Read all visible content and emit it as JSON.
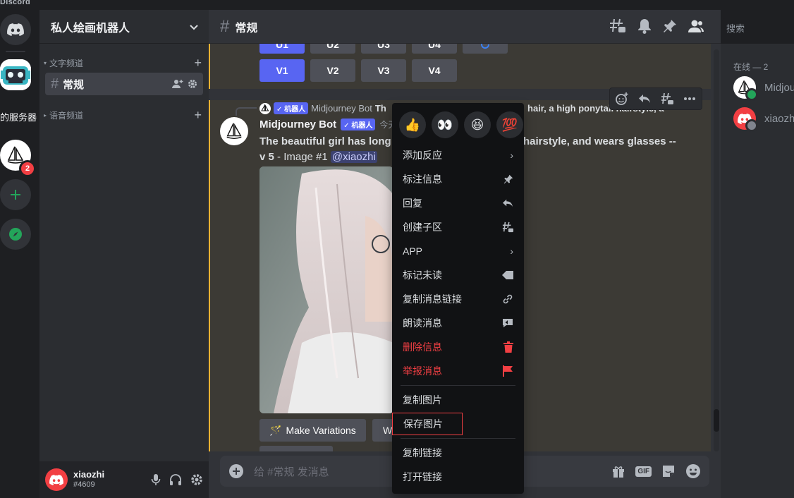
{
  "app": {
    "brand": "Discord"
  },
  "rail": {
    "server_label": "的服务器",
    "badge": "2"
  },
  "guild": {
    "name": "私人绘画机器人"
  },
  "categories": {
    "text": "文字频道",
    "voice": "语音频道"
  },
  "channel": {
    "name": "常规"
  },
  "user": {
    "name": "xiaozhi",
    "tag": "#4609"
  },
  "header": {
    "channel_title": "常规",
    "search_placeholder": "搜索"
  },
  "upscale_buttons_top": [
    "U1",
    "U2",
    "U3",
    "U4"
  ],
  "variation_buttons": [
    "V1",
    "V2",
    "V3",
    "V4"
  ],
  "message": {
    "reply_author": "Midjourney Bot",
    "reply_badge": "✓ 机器人",
    "reply_snippet_left": "Th",
    "reply_snippet_right": "hair, a high ponytail hairstyle, a",
    "author": "Midjourney Bot",
    "author_badge": "✓ 机器人",
    "time": "今天",
    "text_part1": "The beautiful girl has long",
    "text_part2": "hairstyle, and wears glasses --",
    "text_v": "v 5",
    "text_image": " - Image #1 ",
    "mention": "@xiaozhi",
    "make_variations": "Make Variations",
    "web_truncated": "W"
  },
  "composer": {
    "placeholder": "给 #常规 发消息"
  },
  "members": {
    "header": "在线 — 2",
    "list": [
      {
        "name": "Midjou",
        "status": "online"
      },
      {
        "name": "xiaozhi",
        "status": "offline"
      }
    ]
  },
  "context_menu": {
    "reactions": [
      "👍",
      "👀",
      "😆",
      "💯"
    ],
    "items": [
      {
        "label": "添加反应",
        "icon": "chevron-right"
      },
      {
        "label": "标注信息",
        "icon": "pin"
      },
      {
        "label": "回复",
        "icon": "reply"
      },
      {
        "label": "创建子区",
        "icon": "thread"
      },
      {
        "label": "APP",
        "icon": "chevron-right"
      },
      {
        "label": "标记未读",
        "icon": "unread"
      },
      {
        "label": "复制消息链接",
        "icon": "link"
      },
      {
        "label": "朗读消息",
        "icon": "speak"
      },
      {
        "label": "删除信息",
        "icon": "trash",
        "danger": true
      },
      {
        "label": "举报消息",
        "icon": "flag",
        "danger": true
      },
      {
        "label": "复制图片",
        "icon": ""
      },
      {
        "label": "保存图片",
        "icon": ""
      },
      {
        "label": "复制链接",
        "icon": ""
      },
      {
        "label": "打开链接",
        "icon": ""
      }
    ]
  },
  "colors": {
    "accent": "#5865f2",
    "danger": "#f23f43",
    "highlight": "#f0b232",
    "online": "#23a55a"
  }
}
